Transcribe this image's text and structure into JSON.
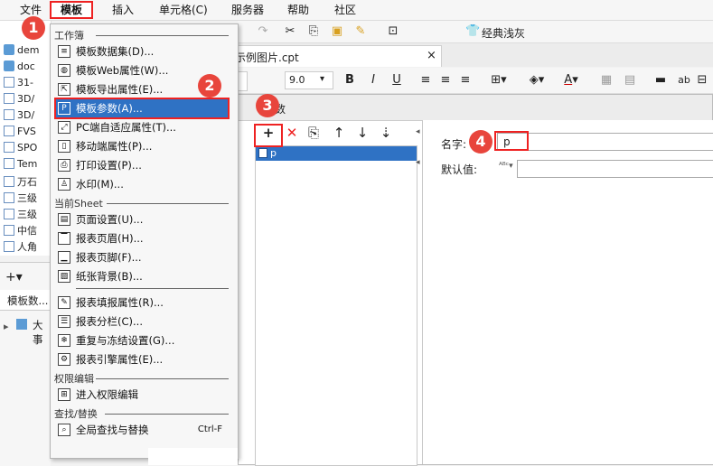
{
  "menubar": {
    "items": [
      "文件",
      "模板",
      "插入",
      "单元格(C)",
      "服务器",
      "帮助",
      "社区"
    ]
  },
  "toolbar": {
    "classic_label": "经典浅灰"
  },
  "tab": {
    "title": "示例图片.cpt",
    "close": "×"
  },
  "format_bar": {
    "font_size": "9.0",
    "bold": "B",
    "italic": "I",
    "underline": "U",
    "ab": "ab"
  },
  "left_tree": {
    "items": [
      "dem",
      "doc",
      "31-",
      "3D/",
      "3D/",
      "FVS",
      "SPO",
      "Tem",
      "万石",
      "三级",
      "三级",
      "中信",
      "人角"
    ]
  },
  "left_bottom": {
    "add": "+▾",
    "tab_label": "模板数...",
    "dataset_item": "大事"
  },
  "dialog": {
    "title": "参数",
    "name_label": "名字:",
    "name_value": "p",
    "default_label": "默认值:",
    "param_selected": "p"
  },
  "dropdown": {
    "sections": [
      {
        "header": "工作簿",
        "items": [
          {
            "label": "模板数据集(D)...",
            "icon": "database-icon"
          },
          {
            "label": "模板Web属性(W)...",
            "icon": "globe-icon"
          },
          {
            "label": "模板导出属性(E)...",
            "icon": "export-icon"
          },
          {
            "label": "模板参数(A)...",
            "icon": "parameter-icon",
            "selected": true
          },
          {
            "label": "PC端自适应属性(T)...",
            "icon": "adaptive-icon"
          },
          {
            "label": "移动端属性(P)...",
            "icon": "mobile-icon"
          },
          {
            "label": "打印设置(P)...",
            "icon": "printer-icon"
          },
          {
            "label": "水印(M)...",
            "icon": "watermark-icon"
          }
        ]
      },
      {
        "header": "当前Sheet",
        "items": [
          {
            "label": "页面设置(U)...",
            "icon": "page-setup-icon"
          },
          {
            "label": "报表页眉(H)...",
            "icon": "header-icon"
          },
          {
            "label": "报表页脚(F)...",
            "icon": "footer-icon"
          },
          {
            "label": "纸张背景(B)...",
            "icon": "background-icon"
          },
          {
            "label": "报表填报属性(R)...",
            "icon": "fill-icon"
          },
          {
            "label": "报表分栏(C)...",
            "icon": "columns-icon"
          },
          {
            "label": "重复与冻结设置(G)...",
            "icon": "freeze-icon"
          },
          {
            "label": "报表引擎属性(E)...",
            "icon": "engine-icon"
          }
        ]
      },
      {
        "header": "权限编辑",
        "items": [
          {
            "label": "进入权限编辑",
            "icon": "permission-icon"
          }
        ]
      },
      {
        "header": "查找/替换",
        "items": [
          {
            "label": "全局查找与替换",
            "icon": "search-icon",
            "shortcut": "Ctrl-F"
          }
        ]
      }
    ]
  },
  "badges": [
    "1",
    "2",
    "3",
    "4"
  ]
}
